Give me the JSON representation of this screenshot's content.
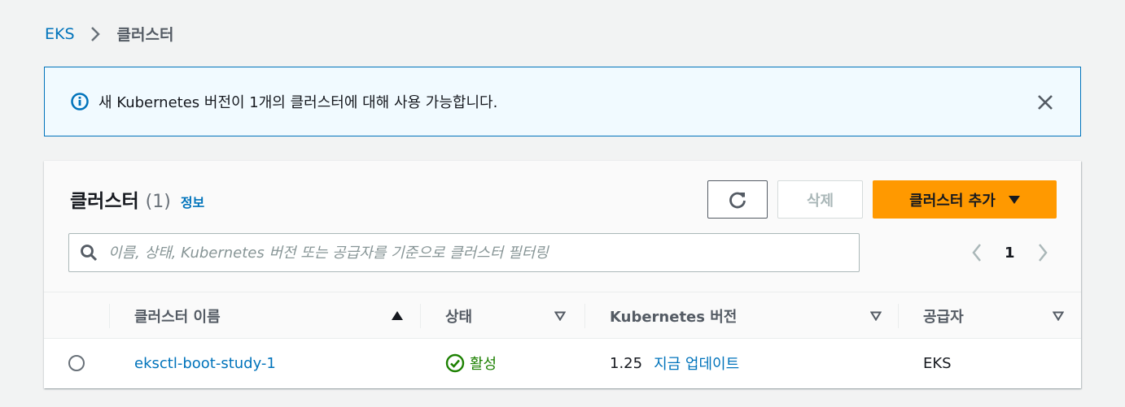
{
  "breadcrumb": {
    "root": "EKS",
    "current": "클러스터"
  },
  "flash": {
    "message": "새 Kubernetes 버전이 1개의 클러스터에 대해 사용 가능합니다."
  },
  "panel": {
    "title": "클러스터",
    "count": "(1)",
    "info_link": "정보",
    "delete_label": "삭제",
    "add_label": "클러스터 추가",
    "search_placeholder": "이름, 상태, Kubernetes 버전 또는 공급자를 기준으로 클러스터 필터링",
    "current_page": "1"
  },
  "table": {
    "columns": [
      "클러스터 이름",
      "상태",
      "Kubernetes 버전",
      "공급자"
    ],
    "rows": [
      {
        "name": "eksctl-boot-study-1",
        "status": "활성",
        "version": "1.25",
        "update_link": "지금 업데이트",
        "provider": "EKS"
      }
    ]
  },
  "colors": {
    "link": "#0073bb",
    "primary_button": "#ff9900",
    "success": "#1d8102",
    "info_border": "#0073bb"
  }
}
